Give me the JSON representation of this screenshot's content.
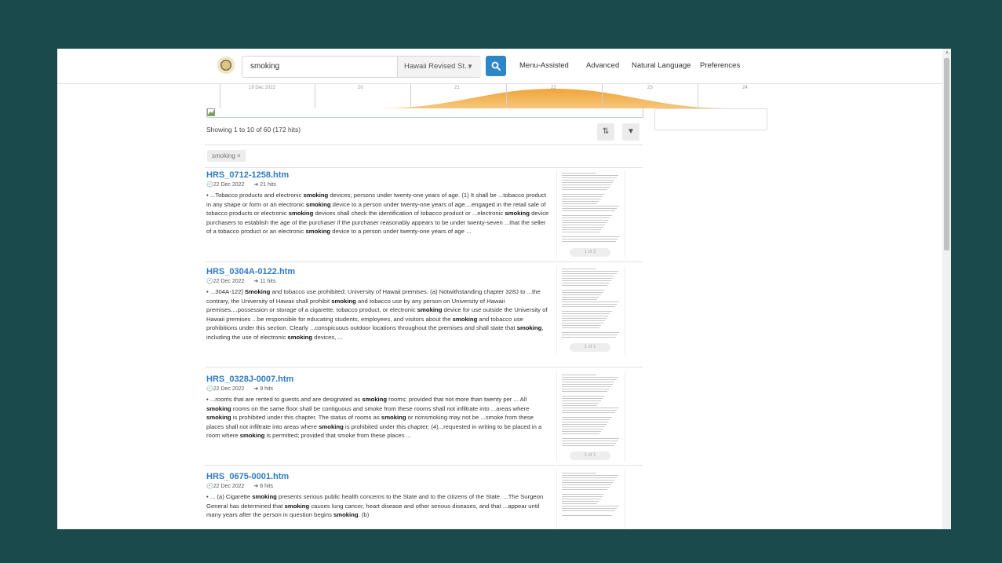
{
  "search": {
    "query": "smoking",
    "collection": "Hawaii Revised St...",
    "button_icon": "search-icon"
  },
  "nav": {
    "menu_assisted": "Menu-Assisted",
    "advanced": "Advanced",
    "natural_language": "Natural Language",
    "preferences": "Preferences"
  },
  "timeline": {
    "labels": [
      "19 Dec 2022",
      "20",
      "21",
      "22",
      "23",
      "24"
    ],
    "accent": "#f2a93a"
  },
  "results_header": {
    "showing": "Showing 1 to 10 of 60 (172 hits)",
    "sort_icon": "sort-icon",
    "filter_icon": "filter-icon"
  },
  "active_filter": {
    "label": "smoking ×"
  },
  "results": [
    {
      "title": "HRS_0712-1258.htm",
      "date": "22 Dec 2022",
      "hits": "21 hits",
      "snippet": "• ...Tobacco products and electronic <b>smoking</b> devices; persons under twenty-one years of age.  (1)  It shall be ...tobacco product in any shape or form or an electronic <b>smoking</b> device to a person under twenty-one years of age....engaged in the retail sale of tobacco products or electronic <b>smoking</b> devices shall check the identification of tobacco product or ...electronic <b>smoking</b> device purchasers to establish the age of the purchaser if the purchaser reasonably appears to be under twenty-seven ...that the seller of a tobacco product or an electronic <b>smoking</b> device to a person under twenty-one years of age ...",
      "page": "1 of 2"
    },
    {
      "title": "HRS_0304A-0122.htm",
      "date": "22 Dec 2022",
      "hits": "11 hits",
      "snippet": "• ...304A-122]  <b>Smoking</b> and tobacco use prohibited; University of Hawaii premises.  (a) Notwithstanding chapter 328J to ...the contrary, the University of Hawaii shall prohibit <b>smoking</b> and tobacco use by any person on University of Hawaii premises....possession or storage of a cigarette, tobacco product, or electronic <b>smoking</b> device for use outside the University of Hawaii premises ...be responsible for educating students, employees, and visitors about the <b>smoking</b> and tobacco use prohibitions under this section.  Clearly ...conspicuous outdoor locations throughout the premises and shall state that <b>smoking</b>, including the use of electronic <b>smoking</b> devices, ...",
      "page": "1 of 1"
    },
    {
      "title": "HRS_0328J-0007.htm",
      "date": "22 Dec 2022",
      "hits": "9 hits",
      "snippet": "• ...rooms that are rented to guests and are designated as <b>smoking</b> rooms; provided that not more than twenty per ...  All <b>smoking</b> rooms on the same floor shall be contiguous and smoke from these rooms shall not infiltrate into ...areas where <b>smoking</b> is prohibited under this chapter.  The status of rooms as <b>smoking</b> or nonsmoking may not be ...smoke from these places shall not infiltrate into areas where <b>smoking</b> is prohibited under this chapter;     (4)...requested in writing to be placed in a room where <b>smoking</b> is permitted; provided that smoke from these places ...",
      "page": "1 of 1"
    },
    {
      "title": "HRS_0675-0001.htm",
      "date": "22 Dec 2022",
      "hits": "8 hits",
      "snippet": "• ...  (a)  Cigarette <b>smoking</b> presents serious public health concerns to the State and to the citizens of the State.  ...The Surgeon General has determined that <b>smoking</b> causes lung cancer, heart disease and other serious diseases, and that ...appear until many years after the person in question begins <b>smoking</b>.     (b)",
      "page": ""
    }
  ]
}
